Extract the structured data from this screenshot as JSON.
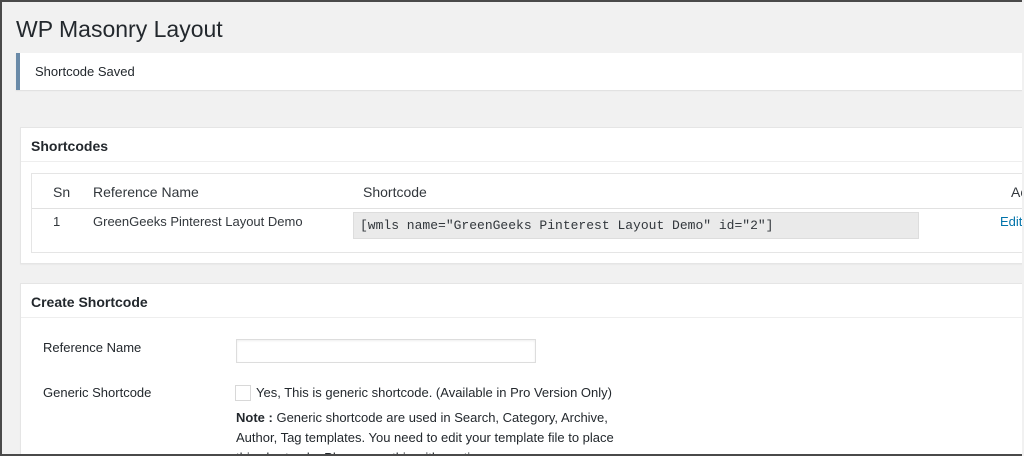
{
  "page": {
    "title": "WP Masonry Layout"
  },
  "notice": {
    "text": "Shortcode Saved"
  },
  "shortcodes_box": {
    "title": "Shortcodes",
    "columns": {
      "sn": "Sn",
      "reference_name": "Reference Name",
      "shortcode": "Shortcode",
      "actions": "Acti"
    },
    "rows": [
      {
        "sn": "1",
        "reference_name": "GreenGeeks Pinterest Layout Demo",
        "shortcode": "[wmls name=\"GreenGeeks Pinterest Layout Demo\" id=\"2\"]",
        "action": "Edit"
      }
    ]
  },
  "create_box": {
    "title": "Create Shortcode",
    "reference_name_label": "Reference Name",
    "reference_name_value": "",
    "generic_label": "Generic Shortcode",
    "generic_checkbox_label": "Yes, This is generic shortcode. (Available in Pro Version Only)",
    "generic_checked": false,
    "note_label": "Note :",
    "note_text": "Generic shortcode are used in Search, Category, Archive, Author, Tag templates. You need to edit your template file to place this shortcode. Please use this with caution."
  },
  "colors": {
    "background": "#f1f1f1",
    "notice_border": "#6a8aa8",
    "link": "#0073aa",
    "code_field_bg": "#eaeaea"
  }
}
